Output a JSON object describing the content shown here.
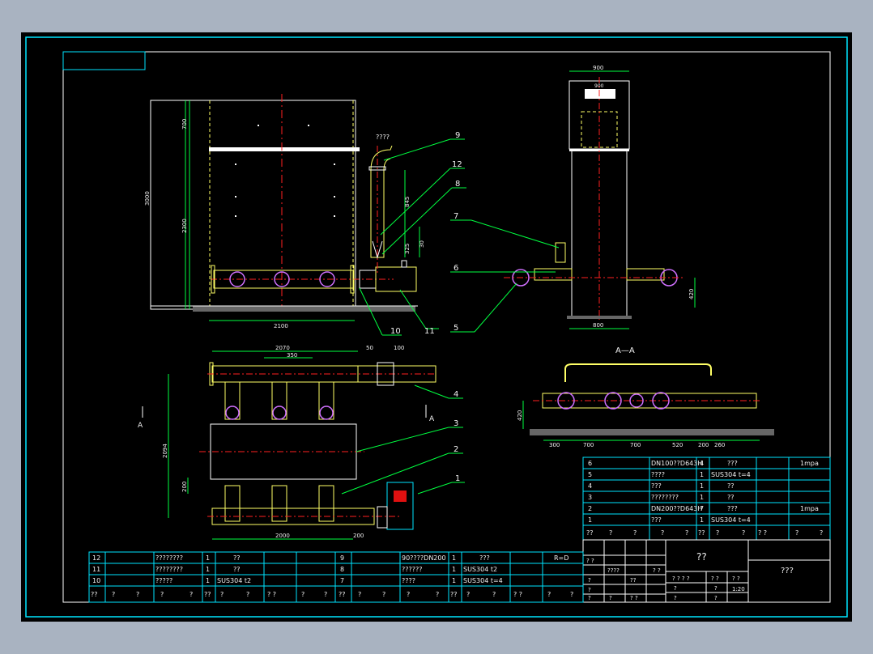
{
  "colors": {
    "background": "#a9b3c1",
    "paper": "#000000",
    "frame": "#00e5ff",
    "outline": "#ffffff",
    "equipment": "#ffff66",
    "centerline": "#ff2020",
    "dimension": "#00ff40",
    "flange": "#d070ff"
  },
  "view_front": {
    "dim_3000": "3000",
    "dim_700": "700",
    "dim_2300": "2300",
    "dim_2100": "2100",
    "dim_845": "845",
    "dim_325": "325",
    "dim_30": "30",
    "pipe_label": "????"
  },
  "view_side": {
    "dim_900": "900",
    "dim_top": "900",
    "dim_800": "800",
    "dim_420": "420"
  },
  "view_plan": {
    "dim_2070": "2070",
    "dim_350": "350",
    "dim_50": "50",
    "dim_100": "100",
    "dim_2094": "2094",
    "dim_200": "200",
    "dim_2000": "2000",
    "dim_200b": "200",
    "section_mark": "A"
  },
  "view_section": {
    "title": "A—A",
    "dim_420": "420",
    "dims": [
      "300",
      "700",
      "700",
      "520",
      "200",
      "260"
    ]
  },
  "callouts": [
    "1",
    "2",
    "3",
    "4",
    "5",
    "6",
    "7",
    "8",
    "9",
    "10",
    "11",
    "12"
  ],
  "bom_right": [
    {
      "no": "6",
      "name": "DN100??D643H",
      "qty": "4",
      "mat": "???",
      "note": "1mpa"
    },
    {
      "no": "5",
      "name": "????",
      "qty": "1",
      "mat": "SUS304  t=4",
      "note": ""
    },
    {
      "no": "4",
      "name": "???",
      "qty": "1",
      "mat": "??",
      "note": ""
    },
    {
      "no": "3",
      "name": "????????",
      "qty": "1",
      "mat": "??",
      "note": ""
    },
    {
      "no": "2",
      "name": "DN200??D643H",
      "qty": "7",
      "mat": "???",
      "note": "1mpa"
    },
    {
      "no": "1",
      "name": "???",
      "qty": "1",
      "mat": "SUS304  t=4",
      "note": ""
    }
  ],
  "bom_right_header": [
    "??",
    "?",
    "?",
    "?",
    "?",
    "??",
    "?",
    "?",
    "? ?",
    "?",
    "?"
  ],
  "bom_left_a": [
    {
      "no": "12",
      "name": "????????",
      "qty": "1",
      "mat": "??"
    },
    {
      "no": "11",
      "name": "????????",
      "qty": "1",
      "mat": "??"
    },
    {
      "no": "10",
      "name": "?????",
      "qty": "1",
      "mat": "SUS304  t2"
    }
  ],
  "bom_left_b": [
    {
      "no": "9",
      "name": "90????DN200",
      "qty": "1",
      "mat": "???",
      "note": "R=D"
    },
    {
      "no": "8",
      "name": "??????",
      "qty": "1",
      "mat": "SUS304  t2",
      "note": ""
    },
    {
      "no": "7",
      "name": "????",
      "qty": "1",
      "mat": "SUS304  t=4",
      "note": ""
    }
  ],
  "bom_left_header": [
    "??",
    "?",
    "?",
    "?",
    "?",
    "??",
    "?",
    "?",
    "? ?",
    "?",
    "?"
  ],
  "title_block": {
    "drawing_name": "??",
    "company": "???",
    "scale": "1:20",
    "cells": [
      "?  ?",
      "????",
      "??",
      "?",
      "?",
      "?",
      "?",
      "?  ?",
      "?  ?",
      "? ? ? ?",
      "? ?",
      "? ?",
      "?",
      "?",
      "?",
      "?"
    ]
  }
}
